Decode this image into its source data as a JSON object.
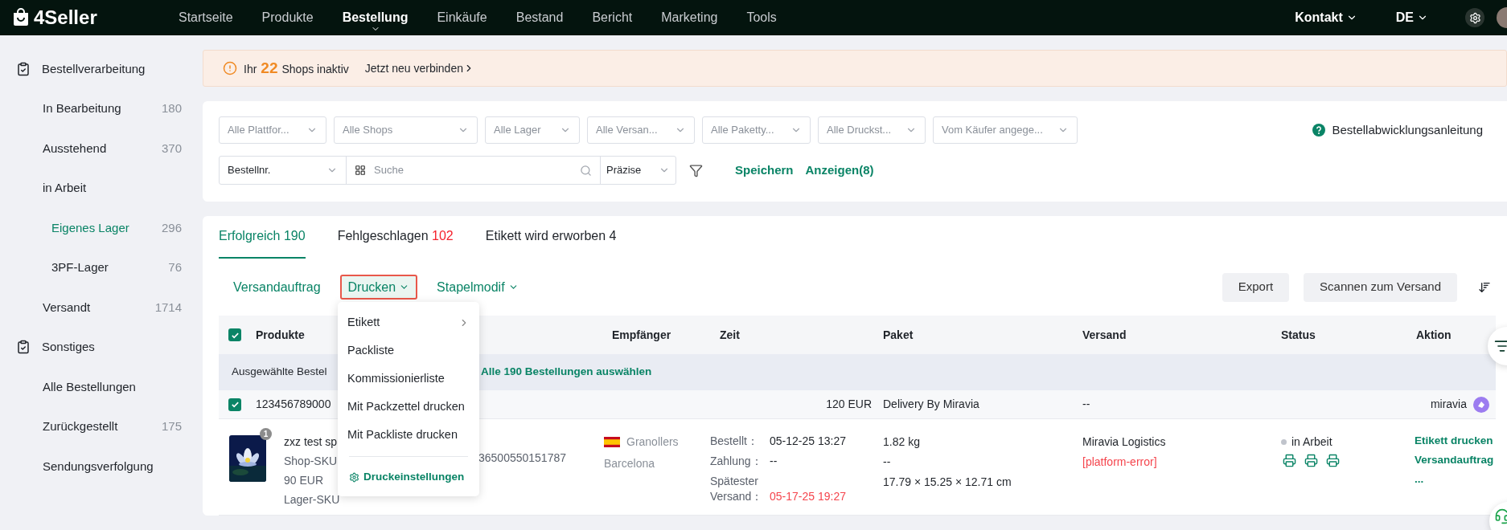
{
  "nav": {
    "logo": "4Seller",
    "items": [
      {
        "label": "Startseite",
        "selected": false
      },
      {
        "label": "Produkte",
        "selected": false
      },
      {
        "label": "Bestellung",
        "selected": true
      },
      {
        "label": "Einkäufe",
        "selected": false
      },
      {
        "label": "Bestand",
        "selected": false
      },
      {
        "label": "Bericht",
        "selected": false
      },
      {
        "label": "Marketing",
        "selected": false
      },
      {
        "label": "Tools",
        "selected": false
      }
    ],
    "contact": "Kontakt",
    "language": "DE"
  },
  "sidebar": {
    "groups": [
      {
        "title": "Bestellverarbeitung",
        "items": [
          {
            "label": "In Bearbeitung",
            "count": "180",
            "selected": false
          },
          {
            "label": "Ausstehend",
            "count": "370",
            "selected": false
          },
          {
            "label": "in Arbeit",
            "selected": false,
            "children": [
              {
                "label": "Eigenes Lager",
                "count": "296",
                "selected": true
              },
              {
                "label": "3PF-Lager",
                "count": "76",
                "selected": false
              }
            ]
          },
          {
            "label": "Versandt",
            "count": "1714",
            "selected": false
          }
        ]
      },
      {
        "title": "Sonstiges",
        "items": [
          {
            "label": "Alle Bestellungen",
            "selected": false
          },
          {
            "label": "Zurückgestellt",
            "count": "175",
            "selected": false
          },
          {
            "label": "Sendungsverfolgung",
            "selected": false
          }
        ]
      }
    ]
  },
  "banner": {
    "prefix": "Ihr",
    "count": "22",
    "suffix": "Shops inaktiv",
    "link": "Jetzt neu verbinden"
  },
  "filters": {
    "selects": [
      "Alle Plattfor...",
      "Alle Shops",
      "Alle Lager",
      "Alle Versan...",
      "Alle Paketty...",
      "Alle Druckst...",
      "Vom Käufer angege..."
    ],
    "help": "Bestellabwicklungsanleitung",
    "search_type": "Bestellnr.",
    "search_placeholder": "Suche",
    "match": "Präzise",
    "save": "Speichern",
    "show": "Anzeigen(8)"
  },
  "tabs": [
    {
      "label": "Erfolgreich",
      "count": "190",
      "selected": true,
      "alert": false
    },
    {
      "label": "Fehlgeschlagen",
      "count": "102",
      "selected": false,
      "alert": true
    },
    {
      "label": "Etikett wird erworben",
      "count": "4",
      "selected": false,
      "alert": false
    }
  ],
  "toolbar": {
    "actions": [
      {
        "label": "Versandauftrag",
        "dropdown": false,
        "open": false
      },
      {
        "label": "Drucken",
        "dropdown": true,
        "open": true
      },
      {
        "label": "Stapelmodif",
        "dropdown": true,
        "open": false
      }
    ],
    "buttons": [
      "Export",
      "Scannen zum Versand"
    ]
  },
  "menu": {
    "items": [
      {
        "label": "Etikett",
        "submenu": true
      },
      {
        "label": "Packliste",
        "submenu": false
      },
      {
        "label": "Kommissionierliste",
        "submenu": false
      },
      {
        "label": "Mit Packzettel drucken",
        "submenu": false
      },
      {
        "label": "Mit Packliste drucken",
        "submenu": false
      }
    ],
    "settings": "Druckeinstellungen"
  },
  "table": {
    "all_checked": true,
    "columns": [
      "Produkte",
      "Empfänger",
      "Zeit",
      "Paket",
      "Versand",
      "Status",
      "Aktion"
    ],
    "selection": {
      "text": "Ausgewählte Bestel",
      "link": "Alle 190 Bestellungen auswählen"
    },
    "order": {
      "checked": true,
      "id": "123456789000",
      "total": "120 EUR",
      "delivery": "Delivery By Miravia",
      "shipping": "--",
      "shop": "miravia"
    },
    "item": {
      "quantity": "1",
      "title": "zxz test sp",
      "shop_sku": "Shop-SKU",
      "price": "90 EUR",
      "warehouse_sku": "Lager-SKU",
      "code": "36500550151787",
      "city": "Granollers",
      "region": "Barcelona",
      "times": [
        {
          "label": "Bestellt：",
          "value": "05-12-25 13:27",
          "overdue": false
        },
        {
          "label": "Zahlung：",
          "value": "--",
          "overdue": false
        },
        {
          "label": "Spätester Versand：",
          "value": "05-17-25 19:27",
          "overdue": true
        }
      ],
      "weight": "1.82 kg",
      "tracking": "--",
      "dimensions": "17.79 × 15.25 × 12.71 cm",
      "carrier": "Miravia Logistics",
      "error": "[platform-error]",
      "status": "in Arbeit",
      "actions": [
        "Etikett drucken",
        "Versandauftrag",
        "..."
      ]
    }
  }
}
